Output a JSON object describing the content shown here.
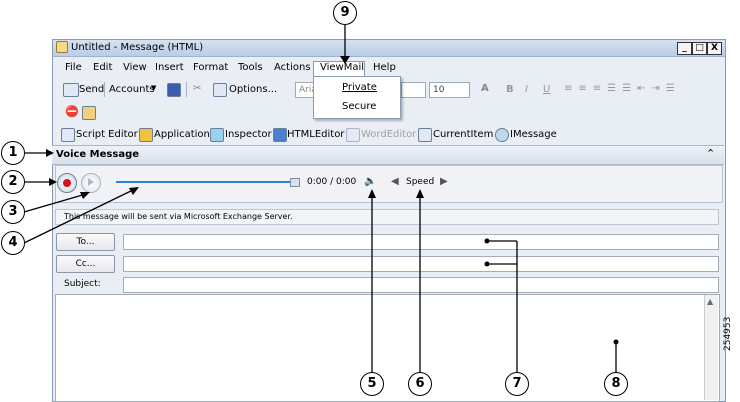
{
  "window": {
    "title": "Untitled - Message (HTML)",
    "min_label": "_",
    "max_label": "□",
    "close_label": "X"
  },
  "menu": [
    "File",
    "Edit",
    "View",
    "Insert",
    "Format",
    "Tools",
    "Actions",
    "ViewMail",
    "Help"
  ],
  "viewmail_menu": {
    "items": [
      "Private",
      "Secure"
    ]
  },
  "toolbar1": {
    "send": "Send",
    "accounts": "Accounts",
    "options": "Options...",
    "font": "Aria",
    "size": "10"
  },
  "toolbar3": {
    "items": [
      "Script Editor",
      "Application",
      "Inspector",
      "HTMLEditor",
      "WordEditor",
      "CurrentItem",
      "IMessage"
    ]
  },
  "voice_message": {
    "title": "Voice Message",
    "time": "0:00 / 0:00",
    "speed": "Speed",
    "progress": 0
  },
  "exchange_notice": "This message will be sent via Microsoft Exchange Server.",
  "fields": {
    "to_label": "To...",
    "cc_label": "Cc...",
    "subject_label": "Subject:"
  },
  "callouts": [
    "1",
    "2",
    "3",
    "4",
    "5",
    "6",
    "7",
    "8",
    "9"
  ],
  "figure_id": "254953"
}
